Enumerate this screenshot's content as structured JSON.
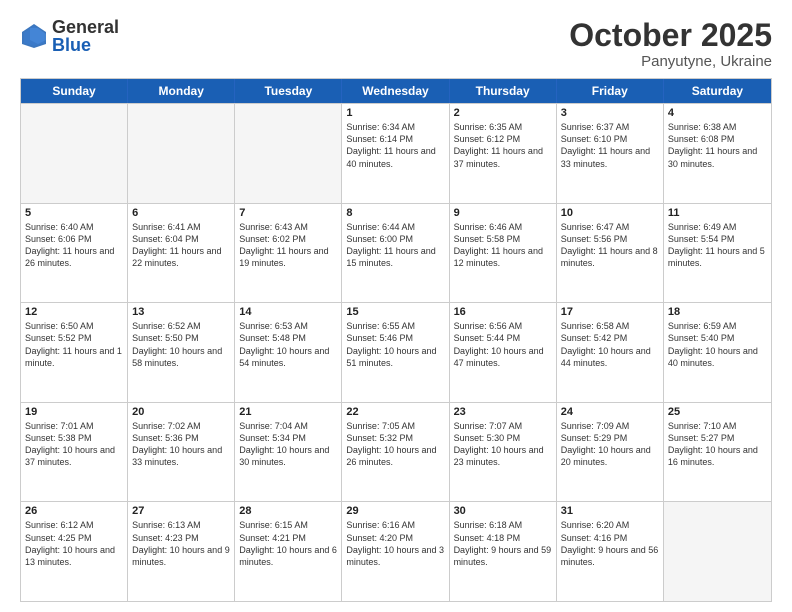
{
  "logo": {
    "general": "General",
    "blue": "Blue"
  },
  "title": "October 2025",
  "location": "Panyutyne, Ukraine",
  "days": [
    "Sunday",
    "Monday",
    "Tuesday",
    "Wednesday",
    "Thursday",
    "Friday",
    "Saturday"
  ],
  "weeks": [
    [
      {
        "day": "",
        "text": ""
      },
      {
        "day": "",
        "text": ""
      },
      {
        "day": "",
        "text": ""
      },
      {
        "day": "1",
        "text": "Sunrise: 6:34 AM\nSunset: 6:14 PM\nDaylight: 11 hours and 40 minutes."
      },
      {
        "day": "2",
        "text": "Sunrise: 6:35 AM\nSunset: 6:12 PM\nDaylight: 11 hours and 37 minutes."
      },
      {
        "day": "3",
        "text": "Sunrise: 6:37 AM\nSunset: 6:10 PM\nDaylight: 11 hours and 33 minutes."
      },
      {
        "day": "4",
        "text": "Sunrise: 6:38 AM\nSunset: 6:08 PM\nDaylight: 11 hours and 30 minutes."
      }
    ],
    [
      {
        "day": "5",
        "text": "Sunrise: 6:40 AM\nSunset: 6:06 PM\nDaylight: 11 hours and 26 minutes."
      },
      {
        "day": "6",
        "text": "Sunrise: 6:41 AM\nSunset: 6:04 PM\nDaylight: 11 hours and 22 minutes."
      },
      {
        "day": "7",
        "text": "Sunrise: 6:43 AM\nSunset: 6:02 PM\nDaylight: 11 hours and 19 minutes."
      },
      {
        "day": "8",
        "text": "Sunrise: 6:44 AM\nSunset: 6:00 PM\nDaylight: 11 hours and 15 minutes."
      },
      {
        "day": "9",
        "text": "Sunrise: 6:46 AM\nSunset: 5:58 PM\nDaylight: 11 hours and 12 minutes."
      },
      {
        "day": "10",
        "text": "Sunrise: 6:47 AM\nSunset: 5:56 PM\nDaylight: 11 hours and 8 minutes."
      },
      {
        "day": "11",
        "text": "Sunrise: 6:49 AM\nSunset: 5:54 PM\nDaylight: 11 hours and 5 minutes."
      }
    ],
    [
      {
        "day": "12",
        "text": "Sunrise: 6:50 AM\nSunset: 5:52 PM\nDaylight: 11 hours and 1 minute."
      },
      {
        "day": "13",
        "text": "Sunrise: 6:52 AM\nSunset: 5:50 PM\nDaylight: 10 hours and 58 minutes."
      },
      {
        "day": "14",
        "text": "Sunrise: 6:53 AM\nSunset: 5:48 PM\nDaylight: 10 hours and 54 minutes."
      },
      {
        "day": "15",
        "text": "Sunrise: 6:55 AM\nSunset: 5:46 PM\nDaylight: 10 hours and 51 minutes."
      },
      {
        "day": "16",
        "text": "Sunrise: 6:56 AM\nSunset: 5:44 PM\nDaylight: 10 hours and 47 minutes."
      },
      {
        "day": "17",
        "text": "Sunrise: 6:58 AM\nSunset: 5:42 PM\nDaylight: 10 hours and 44 minutes."
      },
      {
        "day": "18",
        "text": "Sunrise: 6:59 AM\nSunset: 5:40 PM\nDaylight: 10 hours and 40 minutes."
      }
    ],
    [
      {
        "day": "19",
        "text": "Sunrise: 7:01 AM\nSunset: 5:38 PM\nDaylight: 10 hours and 37 minutes."
      },
      {
        "day": "20",
        "text": "Sunrise: 7:02 AM\nSunset: 5:36 PM\nDaylight: 10 hours and 33 minutes."
      },
      {
        "day": "21",
        "text": "Sunrise: 7:04 AM\nSunset: 5:34 PM\nDaylight: 10 hours and 30 minutes."
      },
      {
        "day": "22",
        "text": "Sunrise: 7:05 AM\nSunset: 5:32 PM\nDaylight: 10 hours and 26 minutes."
      },
      {
        "day": "23",
        "text": "Sunrise: 7:07 AM\nSunset: 5:30 PM\nDaylight: 10 hours and 23 minutes."
      },
      {
        "day": "24",
        "text": "Sunrise: 7:09 AM\nSunset: 5:29 PM\nDaylight: 10 hours and 20 minutes."
      },
      {
        "day": "25",
        "text": "Sunrise: 7:10 AM\nSunset: 5:27 PM\nDaylight: 10 hours and 16 minutes."
      }
    ],
    [
      {
        "day": "26",
        "text": "Sunrise: 6:12 AM\nSunset: 4:25 PM\nDaylight: 10 hours and 13 minutes."
      },
      {
        "day": "27",
        "text": "Sunrise: 6:13 AM\nSunset: 4:23 PM\nDaylight: 10 hours and 9 minutes."
      },
      {
        "day": "28",
        "text": "Sunrise: 6:15 AM\nSunset: 4:21 PM\nDaylight: 10 hours and 6 minutes."
      },
      {
        "day": "29",
        "text": "Sunrise: 6:16 AM\nSunset: 4:20 PM\nDaylight: 10 hours and 3 minutes."
      },
      {
        "day": "30",
        "text": "Sunrise: 6:18 AM\nSunset: 4:18 PM\nDaylight: 9 hours and 59 minutes."
      },
      {
        "day": "31",
        "text": "Sunrise: 6:20 AM\nSunset: 4:16 PM\nDaylight: 9 hours and 56 minutes."
      },
      {
        "day": "",
        "text": ""
      }
    ]
  ]
}
